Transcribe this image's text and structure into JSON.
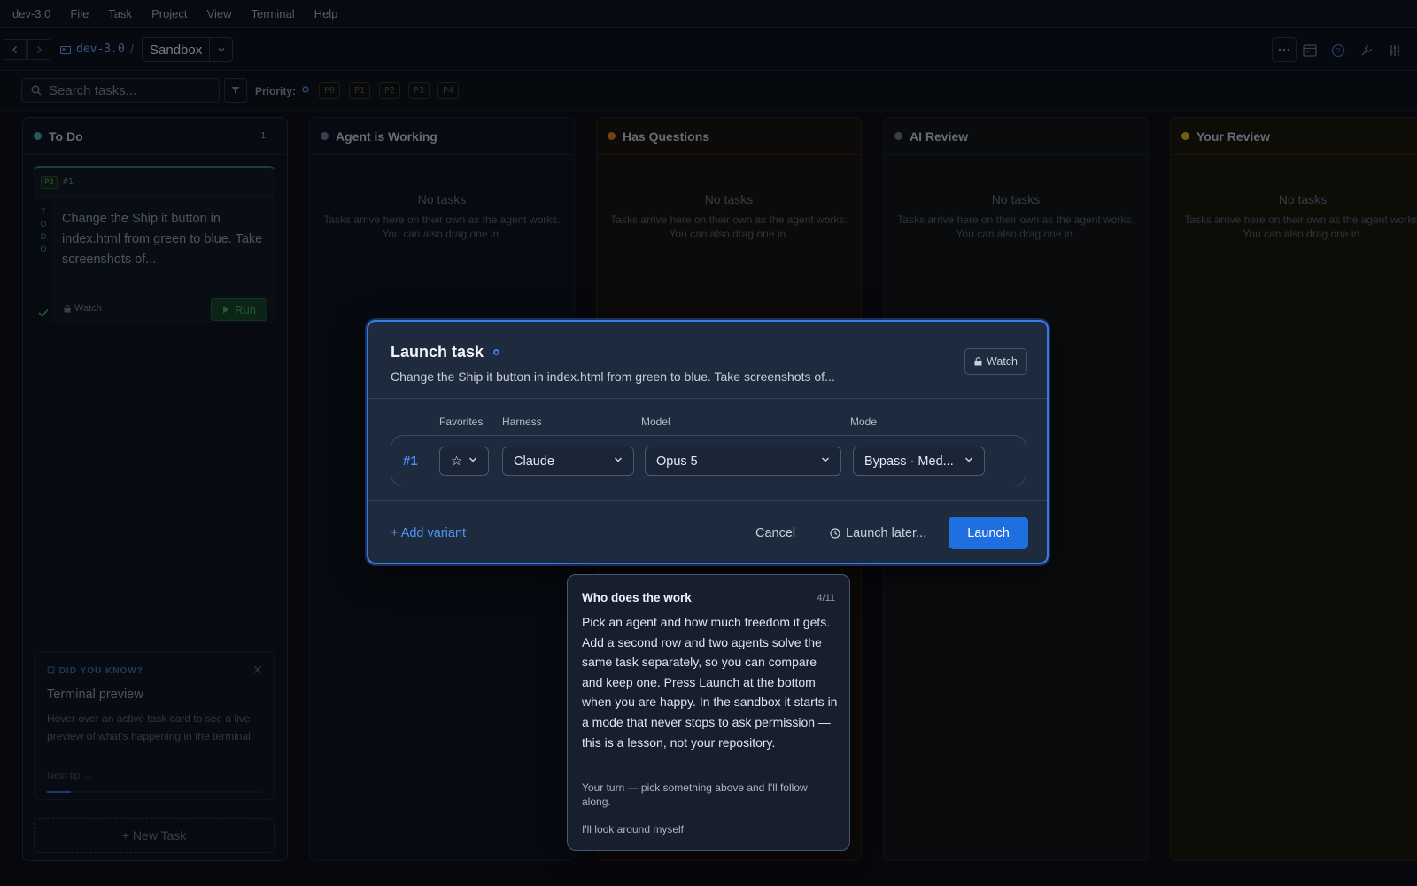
{
  "menubar": {
    "app": "dev-3.0",
    "items": [
      "File",
      "Task",
      "Project",
      "View",
      "Terminal",
      "Help"
    ]
  },
  "topbar": {
    "repo": "dev-3.0",
    "separator": "/",
    "project": "Sandbox"
  },
  "filters": {
    "search_placeholder": "Search tasks...",
    "priority_label": "Priority:",
    "priorities": [
      "P0",
      "P1",
      "P2",
      "P3",
      "P4"
    ]
  },
  "columns": [
    {
      "title": "To Do",
      "count": "1",
      "color": "#3a8f9a"
    },
    {
      "title": "Agent is Working",
      "color": "#5a6a86"
    },
    {
      "title": "Has Questions",
      "color": "#b8641f"
    },
    {
      "title": "AI Review",
      "color": "#5a6272"
    },
    {
      "title": "Your Review",
      "color": "#b39a1c"
    }
  ],
  "empty_state": {
    "title": "No tasks",
    "hint": "Tasks arrive here on their own as the agent works. You can also drag one in."
  },
  "task_card": {
    "priority": "P3",
    "number": "#1",
    "status_letters": [
      "T",
      "O",
      "D",
      "O"
    ],
    "text": "Change the Ship it button in index.html from green to blue. Take screenshots of...",
    "watch": "Watch",
    "run": "Run"
  },
  "tip": {
    "header": "DID YOU KNOW?",
    "title": "Terminal preview",
    "body": "Hover over an active task card to see a live preview of what's happening in the terminal.",
    "next": "Next tip →",
    "progress": 0.11
  },
  "new_task": "+ New Task",
  "modal": {
    "title": "Launch task",
    "subtitle": "Change the Ship it button in index.html from green to blue. Take screenshots of...",
    "watch": "Watch",
    "labels": {
      "favorites": "Favorites",
      "harness": "Harness",
      "model": "Model",
      "mode": "Mode"
    },
    "row": {
      "num": "#1",
      "favorite": "☆",
      "harness": "Claude",
      "model": "Opus 5",
      "mode": "Bypass · Med..."
    },
    "add_variant": "+ Add variant",
    "cancel": "Cancel",
    "launch_later": "Launch later...",
    "launch": "Launch"
  },
  "tour": {
    "title": "Who does the work",
    "step": "4/11",
    "body": "Pick an agent and how much freedom it gets. Add a second row and two agents solve the same task separately, so you can compare and keep one. Press Launch at the bottom when you are happy. In the sandbox it starts in a mode that never stops to ask permission — this is a lesson, not your repository.",
    "prompt": "Your turn — pick something above and I'll follow along.",
    "dismiss": "I'll look around myself"
  },
  "colors": {
    "accent": "#1f6fe0",
    "modal_border": "#3a7ae6",
    "run_green": "#3d8f55"
  }
}
